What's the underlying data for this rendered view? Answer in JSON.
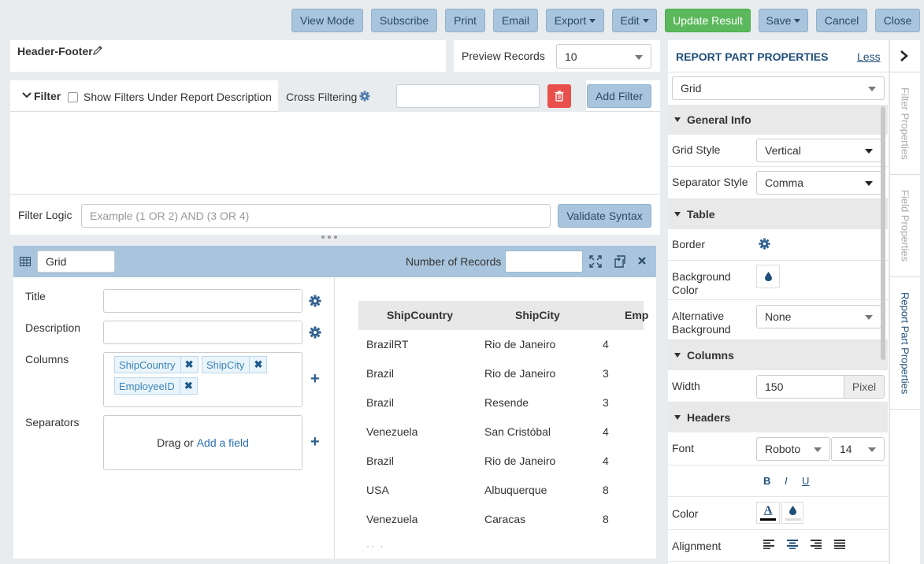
{
  "toolbar": {
    "view_mode": "View Mode",
    "subscribe": "Subscribe",
    "print": "Print",
    "email": "Email",
    "export": "Export",
    "edit": "Edit",
    "update_result": "Update Result",
    "save": "Save",
    "cancel": "Cancel",
    "close": "Close"
  },
  "header": {
    "title": "Header-Footer",
    "preview_label": "Preview Records",
    "preview_value": "10"
  },
  "filter": {
    "title": "Filter",
    "show_under_desc": "Show Filters Under Report Description",
    "cross_filtering": "Cross Filtering",
    "add_filter": "Add Filter",
    "logic_label": "Filter Logic",
    "logic_placeholder": "Example (1 OR 2) AND (3 OR 4)",
    "validate": "Validate Syntax"
  },
  "report_part": {
    "type_value": "Grid",
    "records_label": "Number of Records",
    "fields": {
      "title_label": "Title",
      "description_label": "Description",
      "columns_label": "Columns",
      "separators_label": "Separators",
      "columns": [
        "ShipCountry",
        "ShipCity",
        "EmployeeID"
      ],
      "drag_text": "Drag or",
      "add_field": "Add a field"
    }
  },
  "grid": {
    "headers": [
      "ShipCountry",
      "ShipCity",
      "Emp"
    ],
    "rows": [
      [
        "BrazilRT",
        "Rio de Janeiro",
        "4"
      ],
      [
        "Brazil",
        "Rio de Janeiro",
        "3"
      ],
      [
        "Brazil",
        "Resende",
        "3"
      ],
      [
        "Venezuela",
        "San Cristóbal",
        "4"
      ],
      [
        "Brazil",
        "Rio de Janeiro",
        "4"
      ],
      [
        "USA",
        "Albuquerque",
        "8"
      ],
      [
        "Venezuela",
        "Caracas",
        "8"
      ]
    ]
  },
  "properties": {
    "title": "REPORT PART PROPERTIES",
    "less": "Less",
    "type_value": "Grid",
    "general_info": "General Info",
    "grid_style_label": "Grid Style",
    "grid_style_value": "Vertical",
    "separator_style_label": "Separator Style",
    "separator_style_value": "Comma",
    "table": "Table",
    "border_label": "Border",
    "background_label": "Background Color",
    "alt_background_label": "Alternative Background",
    "alt_background_value": "None",
    "columns": "Columns",
    "width_label": "Width",
    "width_value": "150",
    "width_unit": "Pixel",
    "headers": "Headers",
    "font_label": "Font",
    "font_value": "Roboto",
    "font_size": "14",
    "bold": "B",
    "italic": "I",
    "underline": "U",
    "color_label": "Color",
    "color_letter": "A",
    "alignment_label": "Alignment"
  },
  "side_tabs": [
    "Filter Properties",
    "Field Properties",
    "Report Part Properties"
  ],
  "colors": {
    "accent": "#1f4e79",
    "button_blue": "#a9c5dd",
    "update_green": "#5cb85c",
    "delete_red": "#e9504b",
    "tag_blue": "#3a84b8"
  }
}
